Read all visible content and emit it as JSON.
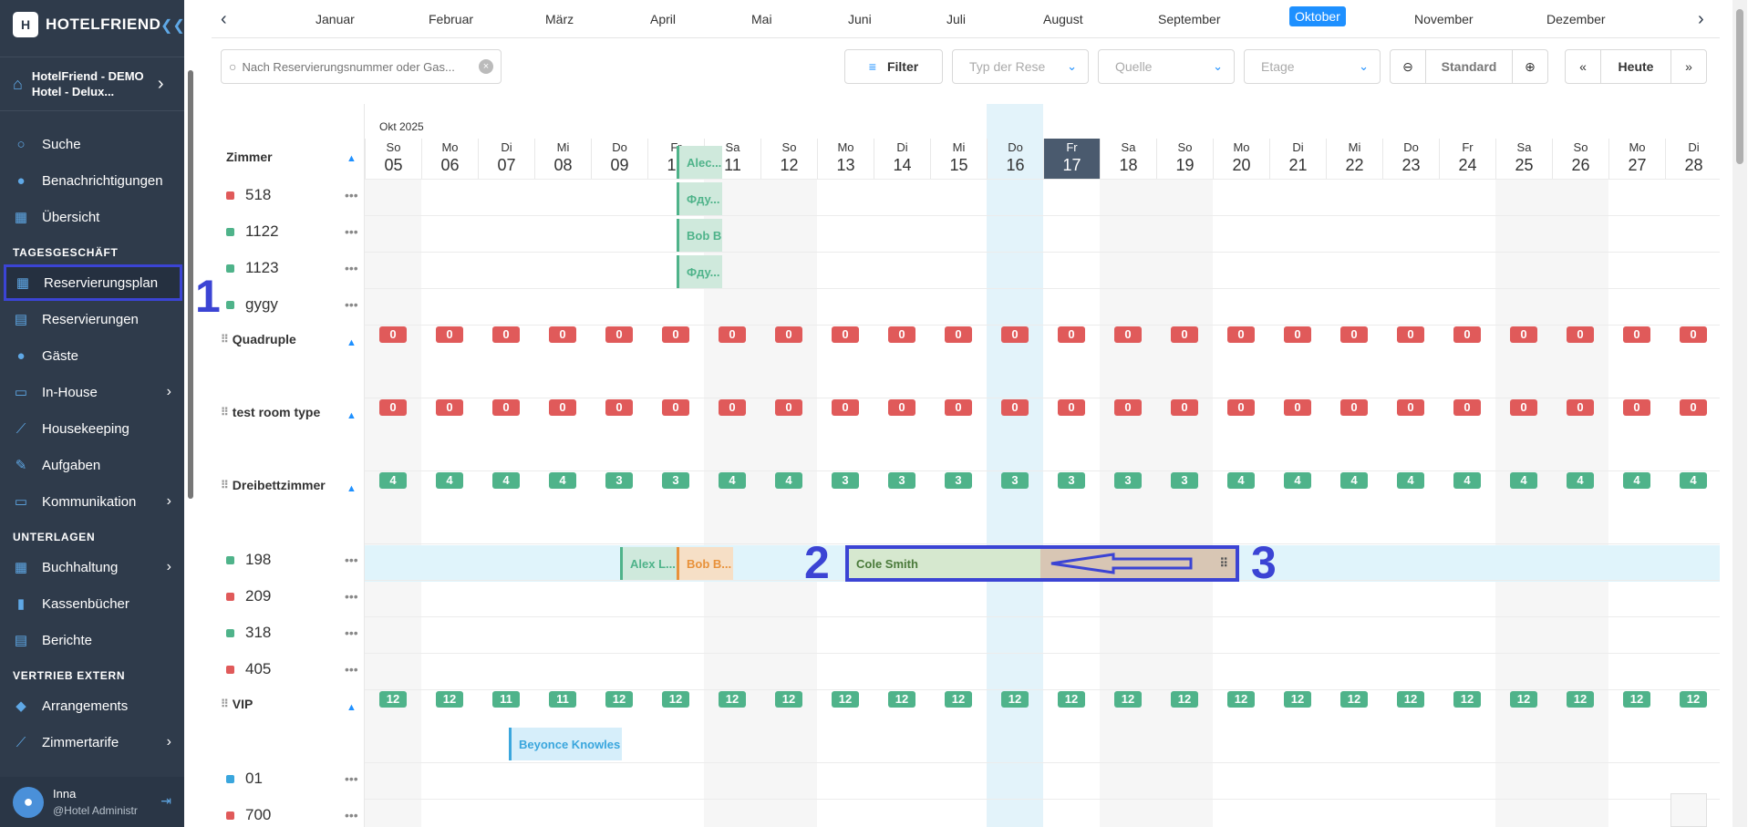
{
  "app": {
    "brand": "HOTELFRIEND",
    "logo_letter": "H"
  },
  "sidebar": {
    "hotel_name": "HotelFriend - DEMO Hotel - Delux...",
    "sections": {
      "tages": "TAGESGESCHÄFT",
      "unterlagen": "UNTERLAGEN",
      "vertrieb": "VERTRIEB EXTERN"
    },
    "items": [
      {
        "label": "Suche",
        "icon": "search-icon"
      },
      {
        "label": "Benachrichtigungen",
        "icon": "bell-icon"
      },
      {
        "label": "Übersicht",
        "icon": "dashboard-icon"
      },
      {
        "label": "Reservierungsplan",
        "icon": "calendar-icon"
      },
      {
        "label": "Reservierungen",
        "icon": "document-icon"
      },
      {
        "label": "Gäste",
        "icon": "person-icon"
      },
      {
        "label": "In-House",
        "icon": "cart-icon"
      },
      {
        "label": "Housekeeping",
        "icon": "broom-icon"
      },
      {
        "label": "Aufgaben",
        "icon": "wrench-icon"
      },
      {
        "label": "Kommunikation",
        "icon": "chat-icon"
      },
      {
        "label": "Buchhaltung",
        "icon": "grid-icon"
      },
      {
        "label": "Kassenbücher",
        "icon": "book-icon"
      },
      {
        "label": "Berichte",
        "icon": "report-icon"
      },
      {
        "label": "Arrangements",
        "icon": "tag-icon"
      },
      {
        "label": "Zimmertarife",
        "icon": "chart-icon"
      }
    ],
    "user": {
      "name": "Inna",
      "role": "@Hotel Administr"
    }
  },
  "months": [
    "Januar",
    "Februar",
    "März",
    "April",
    "Mai",
    "Juni",
    "Juli",
    "August",
    "September",
    "Oktober",
    "November",
    "Dezember"
  ],
  "selected_month": "Oktober",
  "toolbar": {
    "search_placeholder": "Nach Reservierungsnummer oder Gas...",
    "filter": "Filter",
    "type_placeholder": "Typ der Rese",
    "source_placeholder": "Quelle",
    "floor_placeholder": "Etage",
    "zoom_label": "Standard",
    "today": "Heute"
  },
  "calendar": {
    "month_label": "Okt 2025",
    "rooms_header": "Zimmer",
    "days": [
      {
        "w": "So",
        "n": "05"
      },
      {
        "w": "Mo",
        "n": "06"
      },
      {
        "w": "Di",
        "n": "07"
      },
      {
        "w": "Mi",
        "n": "08"
      },
      {
        "w": "Do",
        "n": "09"
      },
      {
        "w": "Fr",
        "n": "10"
      },
      {
        "w": "Sa",
        "n": "11"
      },
      {
        "w": "So",
        "n": "12"
      },
      {
        "w": "Mo",
        "n": "13"
      },
      {
        "w": "Di",
        "n": "14"
      },
      {
        "w": "Mi",
        "n": "15"
      },
      {
        "w": "Do",
        "n": "16"
      },
      {
        "w": "Fr",
        "n": "17"
      },
      {
        "w": "Sa",
        "n": "18"
      },
      {
        "w": "So",
        "n": "19"
      },
      {
        "w": "Mo",
        "n": "20"
      },
      {
        "w": "Di",
        "n": "21"
      },
      {
        "w": "Mi",
        "n": "22"
      },
      {
        "w": "Do",
        "n": "23"
      },
      {
        "w": "Fr",
        "n": "24"
      },
      {
        "w": "Sa",
        "n": "25"
      },
      {
        "w": "So",
        "n": "26"
      },
      {
        "w": "Mo",
        "n": "27"
      },
      {
        "w": "Di",
        "n": "28"
      }
    ],
    "today_index": 12,
    "rooms_top": [
      {
        "name": "518",
        "color": "#e05a5a"
      },
      {
        "name": "1122",
        "color": "#4fb38a"
      },
      {
        "name": "1123",
        "color": "#4fb38a"
      },
      {
        "name": "gygy",
        "color": "#4fb38a"
      }
    ],
    "quadruple": {
      "name": "Quadruple",
      "counts": [
        0,
        0,
        0,
        0,
        0,
        0,
        0,
        0,
        0,
        0,
        0,
        0,
        0,
        0,
        0,
        0,
        0,
        0,
        0,
        0,
        0,
        0,
        0,
        0
      ]
    },
    "test_room": {
      "name": "test room type",
      "counts": [
        0,
        0,
        0,
        0,
        0,
        0,
        0,
        0,
        0,
        0,
        0,
        0,
        0,
        0,
        0,
        0,
        0,
        0,
        0,
        0,
        0,
        0,
        0,
        0
      ]
    },
    "dreibett": {
      "name": "Dreibettzimmer",
      "counts": [
        4,
        4,
        4,
        4,
        3,
        3,
        4,
        4,
        3,
        3,
        3,
        3,
        3,
        3,
        3,
        4,
        4,
        4,
        4,
        4,
        4,
        4,
        4,
        4
      ]
    },
    "rooms_dreibett": [
      {
        "name": "198",
        "color": "#4fb38a"
      },
      {
        "name": "209",
        "color": "#e05a5a"
      },
      {
        "name": "318",
        "color": "#4fb38a"
      },
      {
        "name": "405",
        "color": "#e05a5a"
      }
    ],
    "vip": {
      "name": "VIP",
      "counts": [
        12,
        12,
        11,
        11,
        12,
        12,
        12,
        12,
        12,
        12,
        12,
        12,
        12,
        12,
        12,
        12,
        12,
        12,
        12,
        12,
        12,
        12,
        12,
        12
      ]
    },
    "rooms_vip": [
      {
        "name": "01",
        "color": "#3aa6dd"
      },
      {
        "name": "700",
        "color": "#e05a5a"
      }
    ],
    "bookings": {
      "b518": "Alec...",
      "b1122": "Фду...",
      "b1123": "Bob B...",
      "bgygy": "Фду...",
      "b198a": "Alex L...",
      "b198b": "Bob B...",
      "b198c": "Cole Smith",
      "bvip": "Beyonce Knowles"
    }
  },
  "annotations": {
    "a1": "1",
    "a2": "2",
    "a3": "3"
  }
}
